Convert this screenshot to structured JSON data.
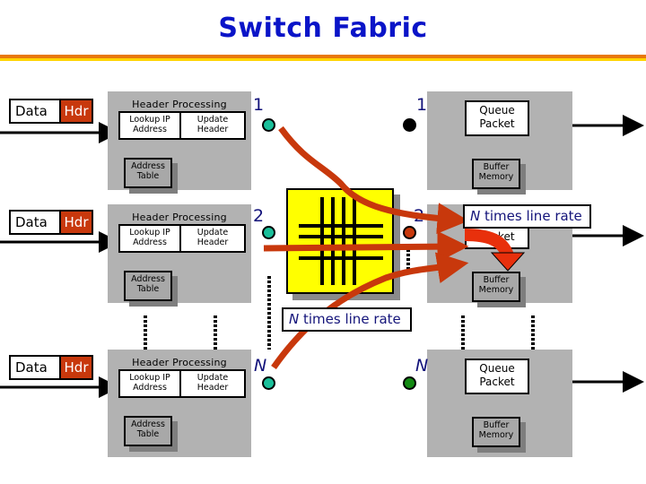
{
  "title": "Switch Fabric",
  "colors": {
    "title": "#0a14c8",
    "rule_orange": "#e8790c",
    "rule_yellow": "#ffd400",
    "hdr_fill": "#c8380c",
    "panel_gray": "#b2b2b2",
    "fabric_yellow": "#ffff00",
    "flow_arrow": "#c8380c",
    "input_dot": "#1abf9a",
    "output_dot_1": "#000000",
    "output_dot_2": "#c8380c",
    "output_dot_N": "#138a13",
    "port_label": "#12127a"
  },
  "line_cards": [
    {
      "packet": {
        "data": "Data",
        "hdr": "Hdr"
      },
      "header_processing": {
        "label": "Header Processing",
        "lookup": "Lookup IP Address",
        "update": "Update Header"
      },
      "address_table": "Address Table",
      "input_port": "1",
      "output_port": "1",
      "queue": "Queue Packet",
      "buffer": "Buffer Memory"
    },
    {
      "packet": {
        "data": "Data",
        "hdr": "Hdr"
      },
      "header_processing": {
        "label": "Header Processing",
        "lookup": "Lookup IP Address",
        "update": "Update Header"
      },
      "address_table": "Address Table",
      "input_port": "2",
      "output_port": "2",
      "queue": "Queue Packet",
      "buffer": "Buffer Memory",
      "callout": "N times line rate"
    },
    {
      "packet": {
        "data": "Data",
        "hdr": "Hdr"
      },
      "header_processing": {
        "label": "Header Processing",
        "lookup": "Lookup IP Address",
        "update": "Update Header"
      },
      "address_table": "Address Table",
      "input_port": "N",
      "output_port": "N",
      "queue": "Queue Packet",
      "buffer": "Buffer Memory"
    }
  ],
  "fabric_callout": "N times line rate"
}
